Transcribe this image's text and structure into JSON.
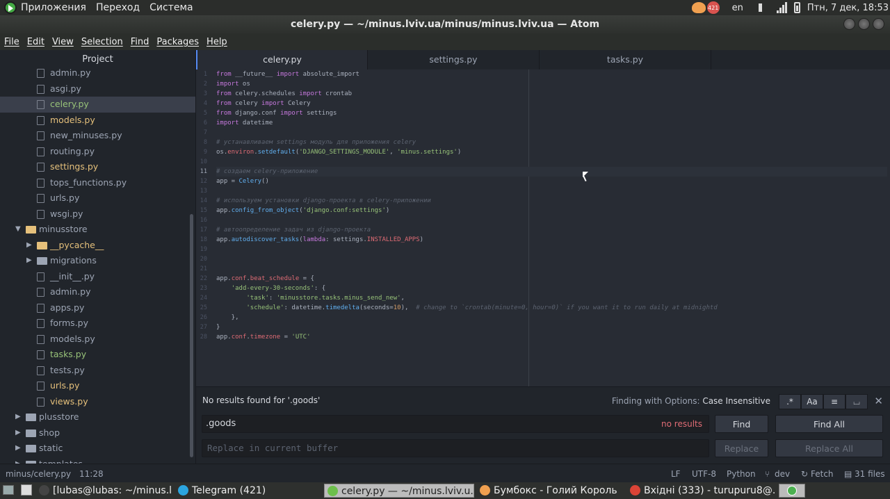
{
  "top_panel": {
    "menus": [
      "Приложения",
      "Переход",
      "Система"
    ],
    "tg_count": "421",
    "lang": "en",
    "clock": "Птн,  7 дек, 18:53"
  },
  "window": {
    "title": "celery.py — ~/minus.lviv.ua/minus/minus.lviv.ua — Atom"
  },
  "menubar": [
    "File",
    "Edit",
    "View",
    "Selection",
    "Find",
    "Packages",
    "Help"
  ],
  "tree": {
    "header": "Project",
    "items": [
      {
        "label": "admin.py",
        "type": "file",
        "color": "",
        "indent": 72
      },
      {
        "label": "asgi.py",
        "type": "file",
        "color": "",
        "indent": 72
      },
      {
        "label": "celery.py",
        "type": "file",
        "color": "green",
        "indent": 72,
        "selected": true
      },
      {
        "label": "models.py",
        "type": "file",
        "color": "yellow",
        "indent": 72
      },
      {
        "label": "new_minuses.py",
        "type": "file",
        "color": "",
        "indent": 72
      },
      {
        "label": "routing.py",
        "type": "file",
        "color": "",
        "indent": 72
      },
      {
        "label": "settings.py",
        "type": "file",
        "color": "yellow",
        "indent": 72
      },
      {
        "label": "tops_functions.py",
        "type": "file",
        "color": "",
        "indent": 72
      },
      {
        "label": "urls.py",
        "type": "file",
        "color": "",
        "indent": 72
      },
      {
        "label": "wsgi.py",
        "type": "file",
        "color": "",
        "indent": 72
      },
      {
        "label": "minusstore",
        "type": "folder-open",
        "color": "",
        "indent": 56
      },
      {
        "label": "__pycache__",
        "type": "folder",
        "color": "yellow",
        "indent": 72
      },
      {
        "label": "migrations",
        "type": "folder",
        "color": "",
        "indent": 72
      },
      {
        "label": "__init__.py",
        "type": "file",
        "color": "",
        "indent": 72
      },
      {
        "label": "admin.py",
        "type": "file",
        "color": "",
        "indent": 72
      },
      {
        "label": "apps.py",
        "type": "file",
        "color": "",
        "indent": 72
      },
      {
        "label": "forms.py",
        "type": "file",
        "color": "",
        "indent": 72
      },
      {
        "label": "models.py",
        "type": "file",
        "color": "",
        "indent": 72
      },
      {
        "label": "tasks.py",
        "type": "file",
        "color": "green",
        "indent": 72
      },
      {
        "label": "tests.py",
        "type": "file",
        "color": "",
        "indent": 72
      },
      {
        "label": "urls.py",
        "type": "file",
        "color": "yellow",
        "indent": 72
      },
      {
        "label": "views.py",
        "type": "file",
        "color": "yellow",
        "indent": 72
      },
      {
        "label": "plusstore",
        "type": "folder",
        "color": "",
        "indent": 56
      },
      {
        "label": "shop",
        "type": "folder",
        "color": "",
        "indent": 56
      },
      {
        "label": "static",
        "type": "folder",
        "color": "",
        "indent": 56
      },
      {
        "label": "templates",
        "type": "folder",
        "color": "",
        "indent": 56
      }
    ]
  },
  "tabs": [
    "celery.py",
    "settings.py",
    "tasks.py"
  ],
  "editor": {
    "current_line": 11,
    "lines": [
      [
        [
          "kw",
          "from"
        ],
        [
          "t",
          " __future__ "
        ],
        [
          "kw",
          "import"
        ],
        [
          "t",
          " absolute_import"
        ]
      ],
      [
        [
          "kw",
          "import"
        ],
        [
          "t",
          " os"
        ]
      ],
      [
        [
          "kw",
          "from"
        ],
        [
          "t",
          " celery.schedules "
        ],
        [
          "kw",
          "import"
        ],
        [
          "t",
          " crontab"
        ]
      ],
      [
        [
          "kw",
          "from"
        ],
        [
          "t",
          " celery "
        ],
        [
          "kw",
          "import"
        ],
        [
          "t",
          " Celery"
        ]
      ],
      [
        [
          "kw",
          "from"
        ],
        [
          "t",
          " django.conf "
        ],
        [
          "kw",
          "import"
        ],
        [
          "t",
          " settings"
        ]
      ],
      [
        [
          "kw",
          "import"
        ],
        [
          "t",
          " datetime"
        ]
      ],
      [],
      [
        [
          "cm",
          "# устанавливаем settings модуль для приложения celery"
        ]
      ],
      [
        [
          "t",
          "os."
        ],
        [
          "cst",
          "environ"
        ],
        [
          "t",
          "."
        ],
        [
          "fn",
          "setdefault"
        ],
        [
          "t",
          "("
        ],
        [
          "str",
          "'DJANGO_SETTINGS_MODULE'"
        ],
        [
          "t",
          ", "
        ],
        [
          "str",
          "'minus.settings'"
        ],
        [
          "t",
          ")"
        ]
      ],
      [],
      [
        [
          "cm",
          "# создаем celery-приложение"
        ]
      ],
      [
        [
          "t",
          "app = "
        ],
        [
          "fn",
          "Celery"
        ],
        [
          "t",
          "()"
        ]
      ],
      [],
      [
        [
          "cm",
          "# используем установки django-проекта в celery-приложении"
        ]
      ],
      [
        [
          "t",
          "app."
        ],
        [
          "fn",
          "config_from_object"
        ],
        [
          "t",
          "("
        ],
        [
          "str",
          "'django.conf:settings'"
        ],
        [
          "t",
          ")"
        ]
      ],
      [],
      [
        [
          "cm",
          "# автоопределение задач из django-проекта"
        ]
      ],
      [
        [
          "t",
          "app."
        ],
        [
          "fn",
          "autodiscover_tasks"
        ],
        [
          "t",
          "("
        ],
        [
          "kw",
          "lambda"
        ],
        [
          "t",
          ": settings."
        ],
        [
          "cst",
          "INSTALLED_APPS"
        ],
        [
          "t",
          ")"
        ]
      ],
      [],
      [],
      [],
      [
        [
          "t",
          "app."
        ],
        [
          "cst",
          "conf"
        ],
        [
          "t",
          "."
        ],
        [
          "cst",
          "beat_schedule"
        ],
        [
          "t",
          " = {"
        ]
      ],
      [
        [
          "t",
          "    "
        ],
        [
          "str",
          "'add-every-30-seconds'"
        ],
        [
          "t",
          ": {"
        ]
      ],
      [
        [
          "t",
          "        "
        ],
        [
          "str",
          "'task'"
        ],
        [
          "t",
          ": "
        ],
        [
          "str",
          "'minusstore.tasks.minus_send_new'"
        ],
        [
          "t",
          ","
        ]
      ],
      [
        [
          "t",
          "        "
        ],
        [
          "str",
          "'schedule'"
        ],
        [
          "t",
          ": datetime."
        ],
        [
          "fn",
          "timedelta"
        ],
        [
          "t",
          "(seconds="
        ],
        [
          "num",
          "10"
        ],
        [
          "t",
          "),  "
        ],
        [
          "cm",
          "# change to `crontab(minute=0, hour=0)` if you want it to run daily at midnightd"
        ]
      ],
      [
        [
          "t",
          "    },"
        ]
      ],
      [
        [
          "t",
          "}"
        ]
      ],
      [
        [
          "t",
          "app."
        ],
        [
          "cst",
          "conf"
        ],
        [
          "t",
          "."
        ],
        [
          "cst",
          "timezone"
        ],
        [
          "t",
          " = "
        ],
        [
          "str",
          "'UTC'"
        ]
      ]
    ]
  },
  "find": {
    "status": "No results found for '.goods'",
    "options_label": "Finding with Options: ",
    "options_value": "Case Insensitive",
    "opt_buttons": [
      ".*",
      "Aa",
      "≡",
      "⌴"
    ],
    "close": "✕",
    "query": ".goods",
    "no_results": "no results",
    "replace_placeholder": "Replace in current buffer",
    "find_btn": "Find",
    "find_all_btn": "Find All",
    "replace_btn": "Replace",
    "replace_all_btn": "Replace All"
  },
  "status": {
    "path": "minus/celery.py",
    "cursor": "11:28",
    "eol": "LF",
    "encoding": "UTF-8",
    "grammar": "Python",
    "branch": "dev",
    "fetch": "Fetch",
    "files": "31 files"
  },
  "taskbar": [
    {
      "label": "[lubas@lubas: ~/minus.lvi...",
      "icon": "terminal"
    },
    {
      "label": "Telegram (421)",
      "icon": "telegram"
    },
    {
      "label": "celery.py — ~/minus.lviv.u...",
      "icon": "atom",
      "active": true
    },
    {
      "label": "Бумбокс - Голий Король",
      "icon": "player"
    },
    {
      "label": "Вхідні (333) - turupuru8@...",
      "icon": "chrome"
    }
  ],
  "colors": {
    "accent": "#568af2",
    "git_added": "#98c379",
    "git_modified": "#e5c07b",
    "error": "#e06c75"
  }
}
